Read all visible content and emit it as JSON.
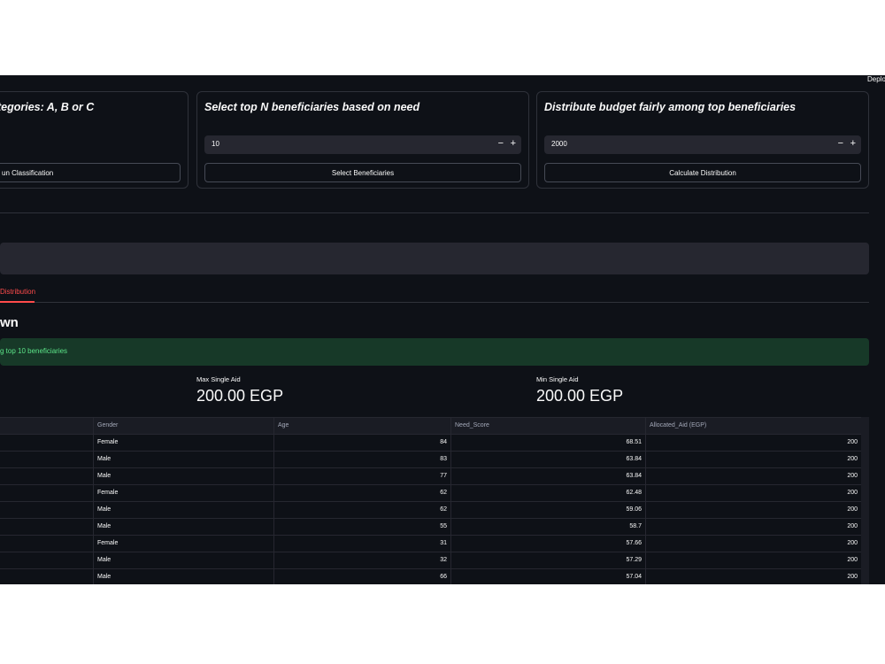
{
  "header": {
    "deploy_label": "Deplo"
  },
  "cards": [
    {
      "title": "tegories: A, B or C",
      "button_label": "un Classification"
    },
    {
      "title": "Select top N beneficiaries based on need",
      "input_value": "10",
      "minus": "−",
      "plus": "+",
      "button_label": "Select Beneficiaries"
    },
    {
      "title": "Distribute budget fairly among top beneficiaries",
      "input_value": "2000",
      "minus": "−",
      "plus": "+",
      "button_label": "Calculate Distribution"
    }
  ],
  "tabs": {
    "active_label": "Distribution"
  },
  "section": {
    "title": "wn"
  },
  "alert": {
    "text": "g top 10 beneficiaries"
  },
  "metrics": [
    {
      "label": "Max Single Aid",
      "value": "200.00 EGP"
    },
    {
      "label": "Min Single Aid",
      "value": "200.00 EGP"
    }
  ],
  "table": {
    "columns": [
      "",
      "Gender",
      "Age",
      "Need_Score",
      "Allocated_Aid (EGP)"
    ],
    "rows": [
      [
        "Female",
        "84",
        "68.51",
        "200"
      ],
      [
        "Male",
        "83",
        "63.84",
        "200"
      ],
      [
        "Male",
        "77",
        "63.84",
        "200"
      ],
      [
        "Female",
        "62",
        "62.48",
        "200"
      ],
      [
        "Male",
        "62",
        "59.06",
        "200"
      ],
      [
        "Male",
        "55",
        "58.7",
        "200"
      ],
      [
        "Female",
        "31",
        "57.66",
        "200"
      ],
      [
        "Male",
        "32",
        "57.29",
        "200"
      ],
      [
        "Male",
        "66",
        "57.04",
        "200"
      ]
    ]
  },
  "colors": {
    "background": "#0e1117",
    "accent": "#ff4b4b",
    "success_bg": "#173928",
    "success_text": "#5ce488",
    "input_bg": "#262730"
  }
}
